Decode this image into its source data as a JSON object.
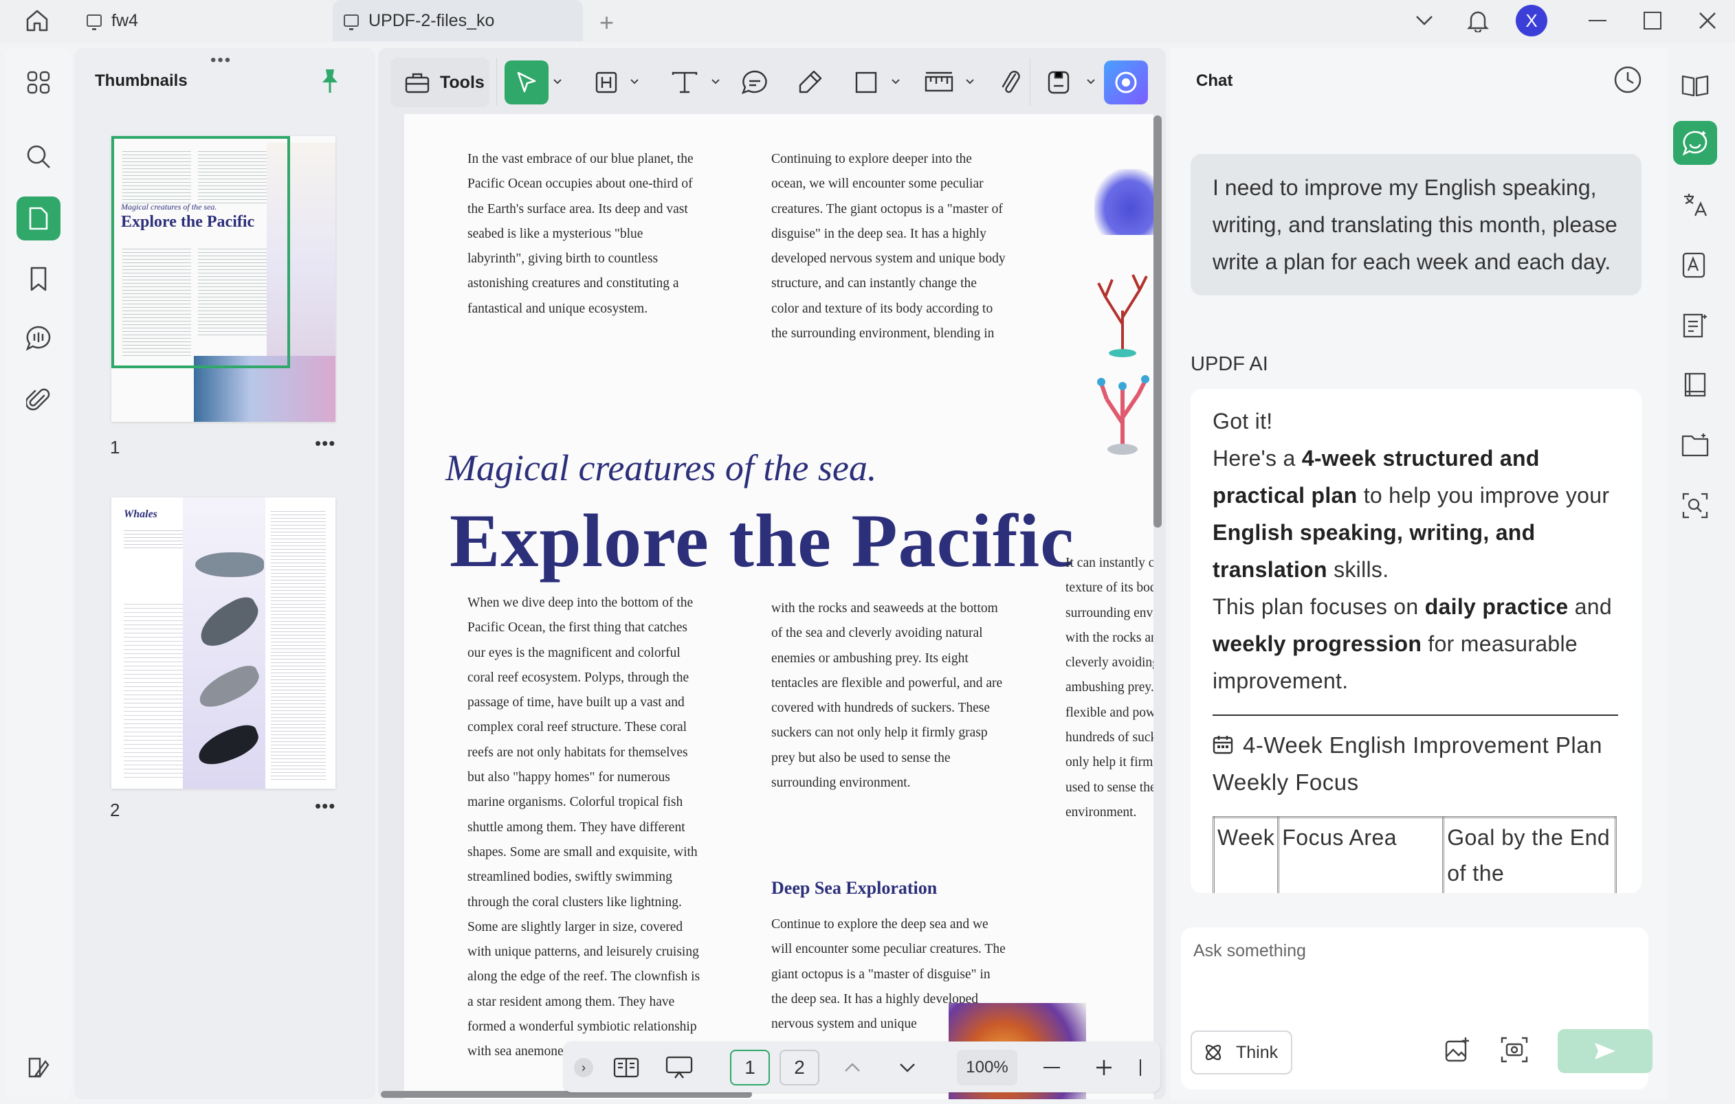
{
  "tabs": [
    {
      "label": "fw4"
    },
    {
      "label": "UPDF-2-files_ko"
    }
  ],
  "user_avatar": "X",
  "colors": {
    "accent": "#2fa86a",
    "title_navy": "#2c2f7a"
  },
  "thumbnails": {
    "title": "Thumbnails",
    "pages": [
      {
        "number": "1",
        "heading_italic": "Magical creatures of the sea.",
        "heading": "Explore the Pacific"
      },
      {
        "number": "2",
        "heading": "Whales"
      }
    ]
  },
  "toolbar": {
    "tools_label": "Tools"
  },
  "document": {
    "col1_top": "In the vast embrace of our blue planet, the\nPacific Ocean occupies about one-third of\nthe Earth's surface area. Its deep and vast\nseabed is like a mysterious \"blue\nlabyrinth\", giving birth to countless\nastonishing creatures and constituting a\nfantastical and unique ecosystem.",
    "col2_top": "Continuing to explore deeper into the\nocean, we will encounter some peculiar\ncreatures. The giant octopus is a \"master of\ndisguise\" in the deep sea. It has a highly\ndeveloped nervous system and unique body\nstructure, and can instantly change the\ncolor and texture of its body according to\nthe surrounding environment, blending in",
    "subtitle": "Magical creatures of the sea.",
    "title": "Explore the Pacific",
    "col1_bottom": "When we dive deep into the bottom of the\nPacific Ocean, the first thing that catches\nour eyes is the magnificent and colorful\ncoral reef ecosystem. Polyps, through the\npassage of time, have built up a vast and\ncomplex coral reef structure. These coral\nreefs are not only habitats for themselves\nbut also \"happy homes\" for numerous\nmarine organisms. Colorful tropical fish\nshuttle among them. They have different\nshapes. Some are small and exquisite, with\nstreamlined bodies, swiftly swimming\nthrough the coral clusters like lightning.\nSome are slightly larger in size, covered\nwith unique patterns, and leisurely cruising\nalong the edge of the reef. The clownfish is\na star resident among them. They have\nformed a wonderful symbiotic relationship\nwith sea anemones",
    "col2_bottom": "with the rocks and seaweeds at the bottom\nof the sea and cleverly avoiding natural\nenemies or ambushing prey. Its eight\ntentacles are flexible and powerful, and are\ncovered with hundreds of suckers. These\nsuckers can not only help it firmly grasp\nprey but also be used to sense the\nsurrounding environment.",
    "section_heading": "Deep Sea Exploration",
    "col2_section": "Continue to explore the deep sea and we\nwill encounter some peculiar creatures. The\ngiant octopus is a \"master of disguise\" in\nthe deep sea. It has a highly developed\nnervous system and unique\nbody structure.",
    "col3": "It can instantly cha\ntexture of its body\nsurrounding envir\nwith the rocks and\ncleverly avoiding\nambushing prey. I\nflexible and power\nhundreds of sucke\nonly help it firmly\nused to sense the s\nenvironment."
  },
  "pager": {
    "current_page": "1",
    "other_page": "2",
    "zoom": "100%"
  },
  "chat": {
    "title": "Chat",
    "user_message": "I need to improve my English speaking, writing, and translating this month, please write a plan for each week and each day.",
    "ai_label": "UPDF AI",
    "ai_got_it": "Got it!",
    "ai_p1_a": "Here's a ",
    "ai_p1_b": "4-week structured and practical plan",
    "ai_p1_c": " to help you improve your ",
    "ai_p1_d": "English speaking, writing, and translation",
    "ai_p1_e": " skills.",
    "ai_p2_a": "This plan focuses on ",
    "ai_p2_b": "daily practice",
    "ai_p2_c": " and ",
    "ai_p2_d": "weekly progression",
    "ai_p2_e": " for measurable improvement.",
    "plan_title": "4-Week English Improvement Plan",
    "plan_subtitle": "Weekly Focus",
    "table_headers": [
      "Week",
      "Focus Area",
      "Goal by the End of the"
    ],
    "ask_placeholder": "Ask something",
    "think_label": "Think"
  }
}
